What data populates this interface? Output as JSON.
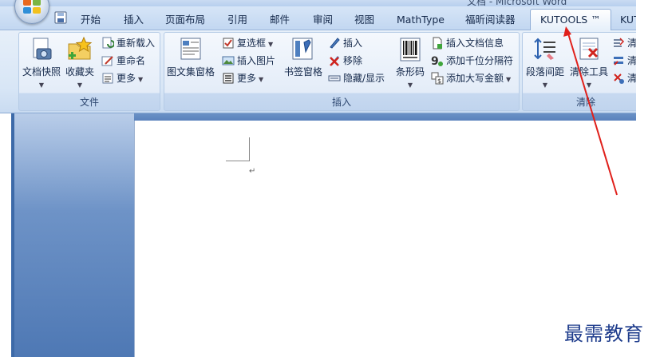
{
  "window": {
    "title": "文档 - Microsoft Word"
  },
  "tabs": [
    {
      "label": "开始"
    },
    {
      "label": "插入"
    },
    {
      "label": "页面布局"
    },
    {
      "label": "引用"
    },
    {
      "label": "邮件"
    },
    {
      "label": "审阅"
    },
    {
      "label": "视图"
    },
    {
      "label": "MathType"
    },
    {
      "label": "福昕阅读器"
    },
    {
      "label": "KUTOOLS ™"
    },
    {
      "label": "KUT"
    }
  ],
  "groups": {
    "file": {
      "label": "文件",
      "big": [
        {
          "label": "文档快照",
          "icon": "camera-document-icon"
        },
        {
          "label": "收藏夹",
          "icon": "star-folder-icon"
        }
      ],
      "small": [
        {
          "label": "重新载入",
          "icon": "reload-icon"
        },
        {
          "label": "重命名",
          "icon": "rename-icon"
        },
        {
          "label": "更多",
          "icon": "more-icon"
        }
      ]
    },
    "insert": {
      "label": "插入",
      "big": [
        {
          "label": "图文集窗格",
          "icon": "autotext-pane-icon"
        },
        {
          "label": "书签窗格",
          "icon": "bookmark-pane-icon"
        },
        {
          "label": "条形码",
          "icon": "barcode-icon"
        }
      ],
      "col1": [
        {
          "label": "复选框",
          "icon": "checkbox-icon"
        },
        {
          "label": "插入图片",
          "icon": "insert-picture-icon"
        },
        {
          "label": "更多",
          "icon": "more-icon"
        }
      ],
      "col2": [
        {
          "label": "插入",
          "icon": "insert-bookmark-icon"
        },
        {
          "label": "移除",
          "icon": "remove-icon"
        },
        {
          "label": "隐藏/显示",
          "icon": "hide-show-icon"
        }
      ],
      "col3": [
        {
          "label": "插入文档信息",
          "icon": "doc-info-icon"
        },
        {
          "label": "添加千位分隔符",
          "icon": "thousands-separator-icon"
        },
        {
          "label": "添加大写金额",
          "icon": "currency-uppercase-icon"
        }
      ]
    },
    "clear": {
      "label": "清除",
      "big": [
        {
          "label": "段落间距",
          "icon": "paragraph-spacing-icon"
        },
        {
          "label": "清除工具",
          "icon": "clear-tool-icon"
        }
      ],
      "small": [
        {
          "label": "清",
          "icon": "clear-icon-1"
        },
        {
          "label": "清",
          "icon": "clear-icon-2"
        },
        {
          "label": "清",
          "icon": "clear-icon-3"
        }
      ]
    }
  },
  "document": {
    "pilcrow": "↵"
  },
  "watermark": "最需教育",
  "annotation": {
    "color": "#e0201b"
  },
  "colors": {
    "ribbon_bg": "#dfeaf7",
    "active_tab_border": "#8fadd6",
    "pane_blue": "#5a82bd"
  }
}
